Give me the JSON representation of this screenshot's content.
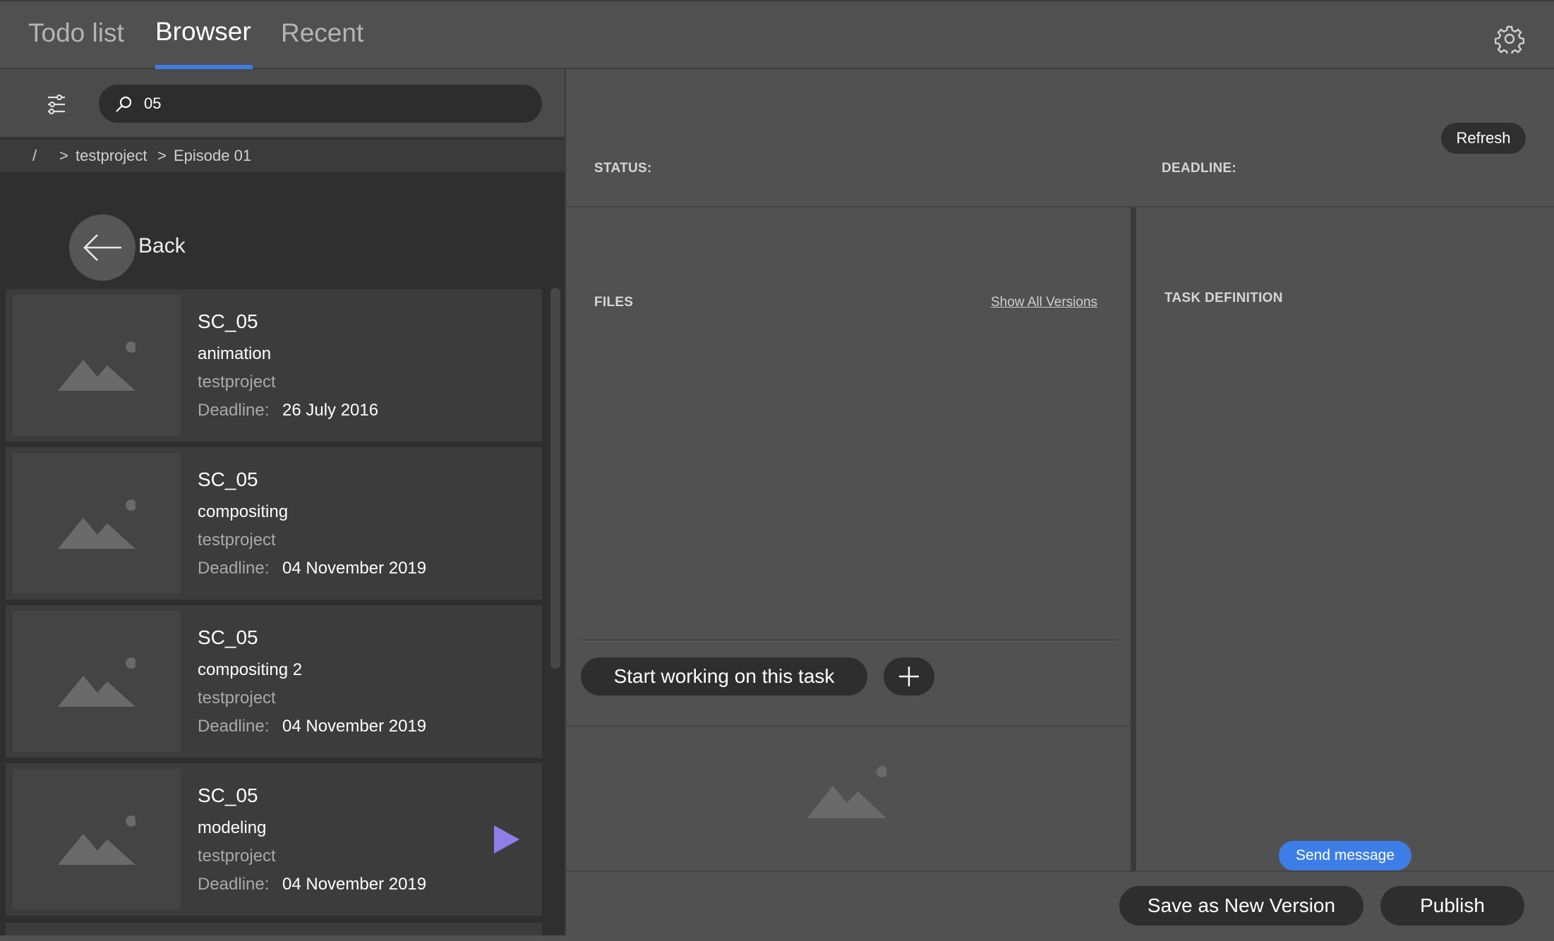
{
  "tabs": [
    {
      "label": "Todo list",
      "active": false
    },
    {
      "label": "Browser",
      "active": true
    },
    {
      "label": "Recent",
      "active": false
    }
  ],
  "settings_icon": "gear-icon",
  "search": {
    "value": "05",
    "icon": "search-icon"
  },
  "filter_icon": "sliders-icon",
  "breadcrumb": {
    "root": "/",
    "sep1": ">",
    "item1": "testproject",
    "sep2": ">",
    "item2": "Episode 01"
  },
  "back": {
    "label": "Back",
    "icon": "arrow-left-icon"
  },
  "tasks": [
    {
      "title": "SC_05",
      "task": "animation",
      "project": "testproject",
      "deadline_label": "Deadline:",
      "deadline": "26 July 2016"
    },
    {
      "title": "SC_05",
      "task": "compositing",
      "project": "testproject",
      "deadline_label": "Deadline:",
      "deadline": "04 November 2019"
    },
    {
      "title": "SC_05",
      "task": "compositing 2",
      "project": "testproject",
      "deadline_label": "Deadline:",
      "deadline": "04 November 2019"
    },
    {
      "title": "SC_05",
      "task": "modeling",
      "project": "testproject",
      "deadline_label": "Deadline:",
      "deadline": "04 November 2019"
    }
  ],
  "detail": {
    "refresh": "Refresh",
    "status_label": "STATUS:",
    "deadline_label": "DEADLINE:",
    "files_label": "FILES",
    "show_all_versions": "Show All Versions",
    "start_task": "Start working on this task",
    "task_definition_label": "TASK DEFINITION",
    "send_message": "Send message",
    "save_new_version": "Save as New Version",
    "publish": "Publish"
  },
  "colors": {
    "accent": "#3d7ee6",
    "play": "#8f7ee8",
    "panel_dark": "#2f2f2f",
    "panel": "#515151"
  }
}
